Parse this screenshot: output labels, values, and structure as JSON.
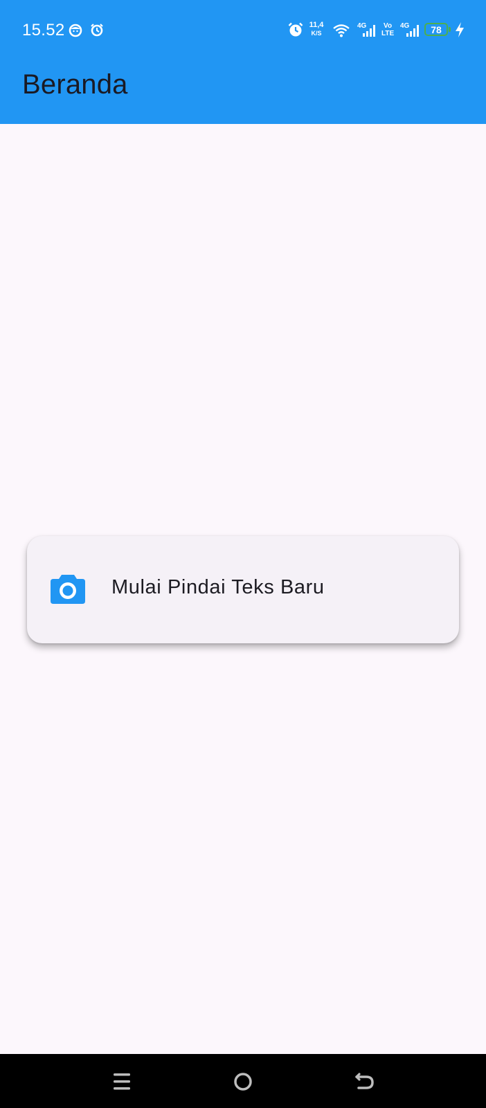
{
  "status_bar": {
    "time": "15.52",
    "net_speed_value": "11,4",
    "net_speed_unit": "K/S",
    "sim1_network": "4G",
    "volte_top": "Vo",
    "volte_bottom": "LTE",
    "sim2_network": "4G",
    "battery_level": "78",
    "battery_color": "#4caf50",
    "icons": [
      "face-notification-icon",
      "alarm-icon",
      "alarm-icon",
      "wifi-icon",
      "signal-icon",
      "signal-icon",
      "battery-icon",
      "charging-icon"
    ]
  },
  "app_bar": {
    "title": "Beranda",
    "color": "#2196f3"
  },
  "main": {
    "scan_button": {
      "label": "Mulai Pindai Teks Baru",
      "icon": "camera-icon",
      "icon_color": "#2196f3"
    }
  },
  "nav_bar": {
    "items": [
      "menu-icon",
      "home-icon",
      "back-icon"
    ]
  }
}
